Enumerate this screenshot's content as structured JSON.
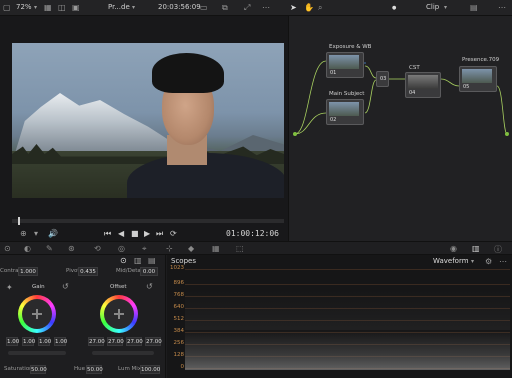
{
  "topbar": {
    "zoom": "72%",
    "clip_name": "Pr...de",
    "timecode": "20:03:56:09",
    "mode": "Clip"
  },
  "viewer": {
    "timecode": "01:00:12:06"
  },
  "nodes": [
    {
      "label": "Exposure & WB",
      "num": "01"
    },
    {
      "label": "Main Subject",
      "num": "02"
    },
    {
      "label": "CST",
      "num": "04"
    },
    {
      "label": "Presence.709",
      "num": "05"
    },
    {
      "label": "",
      "num": "03"
    }
  ],
  "primaries": {
    "contrast_label": "Contrast",
    "contrast": "1.000",
    "pivot_label": "Pivot",
    "pivot": "0.435",
    "mid_detail_label": "Mid/Detail",
    "mid_detail": "0.00",
    "gain_label": "Gain",
    "gain_values": [
      "1.00",
      "1.00",
      "1.00",
      "1.00"
    ],
    "offset_label": "Offset",
    "offset_values": [
      "27.00",
      "27.00",
      "27.00",
      "27.00"
    ],
    "saturation_label": "Saturation",
    "saturation": "50.00",
    "hue_label": "Hue",
    "hue": "50.00",
    "lum_mix_label": "Lum Mix",
    "lum_mix": "100.00"
  },
  "scopes": {
    "title": "Scopes",
    "type": "Waveform",
    "scale": [
      "1023",
      "896",
      "768",
      "640",
      "512",
      "384",
      "256",
      "128",
      "0"
    ]
  }
}
